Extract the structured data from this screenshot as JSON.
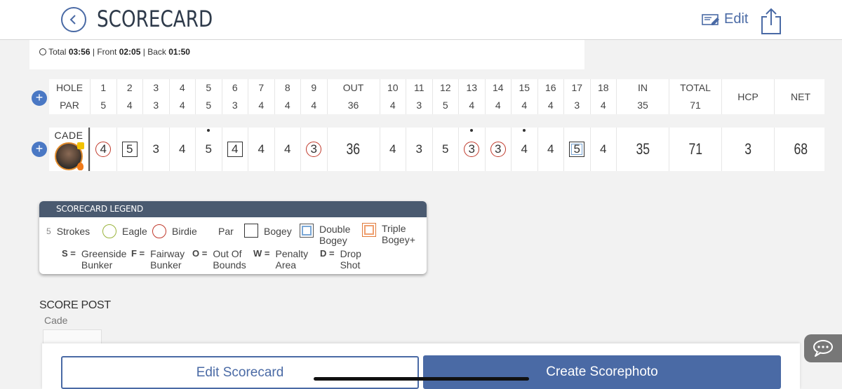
{
  "header": {
    "title": "SCORECARD",
    "edit_label": "Edit",
    "icons": [
      "back-icon",
      "edit-card-icon",
      "share-icon"
    ],
    "accent_color": "#4a6aa5"
  },
  "timebar": {
    "total_label": "Total",
    "total_value": "03:56",
    "front_label": "Front",
    "front_value": "02:05",
    "back_label": "Back",
    "back_value": "01:50",
    "sep": "|"
  },
  "holes": {
    "hole_label": "HOLE",
    "par_label": "PAR",
    "front": [
      {
        "hole": "1",
        "par": "5"
      },
      {
        "hole": "2",
        "par": "4"
      },
      {
        "hole": "3",
        "par": "3"
      },
      {
        "hole": "4",
        "par": "4"
      },
      {
        "hole": "5",
        "par": "5"
      },
      {
        "hole": "6",
        "par": "3"
      },
      {
        "hole": "7",
        "par": "4"
      },
      {
        "hole": "8",
        "par": "4"
      },
      {
        "hole": "9",
        "par": "4"
      }
    ],
    "out_label": "OUT",
    "out_par": "36",
    "back": [
      {
        "hole": "10",
        "par": "4"
      },
      {
        "hole": "11",
        "par": "3"
      },
      {
        "hole": "12",
        "par": "5"
      },
      {
        "hole": "13",
        "par": "4"
      },
      {
        "hole": "14",
        "par": "4"
      },
      {
        "hole": "15",
        "par": "4"
      },
      {
        "hole": "16",
        "par": "4"
      },
      {
        "hole": "17",
        "par": "3"
      },
      {
        "hole": "18",
        "par": "4"
      }
    ],
    "in_label": "IN",
    "in_par": "35",
    "total_label": "TOTAL",
    "total_par": "71",
    "hcp_label": "HCP",
    "net_label": "NET"
  },
  "player": {
    "name": "CADE",
    "front": [
      {
        "score": "4",
        "mark": "birdie",
        "dot": false
      },
      {
        "score": "5",
        "mark": "bogey",
        "dot": false
      },
      {
        "score": "3",
        "mark": "par",
        "dot": false
      },
      {
        "score": "4",
        "mark": "par",
        "dot": false
      },
      {
        "score": "5",
        "mark": "par",
        "dot": true
      },
      {
        "score": "4",
        "mark": "bogey",
        "dot": false
      },
      {
        "score": "4",
        "mark": "par",
        "dot": false
      },
      {
        "score": "4",
        "mark": "par",
        "dot": false
      },
      {
        "score": "3",
        "mark": "birdie",
        "dot": false
      }
    ],
    "out": "36",
    "back": [
      {
        "score": "4",
        "mark": "par",
        "dot": false
      },
      {
        "score": "3",
        "mark": "par",
        "dot": false
      },
      {
        "score": "5",
        "mark": "par",
        "dot": false
      },
      {
        "score": "3",
        "mark": "birdie",
        "dot": true
      },
      {
        "score": "3",
        "mark": "birdie",
        "dot": false
      },
      {
        "score": "4",
        "mark": "par",
        "dot": true
      },
      {
        "score": "4",
        "mark": "par",
        "dot": false
      },
      {
        "score": "5",
        "mark": "double-bogey",
        "dot": false
      },
      {
        "score": "4",
        "mark": "par",
        "dot": false
      }
    ],
    "in": "35",
    "total": "71",
    "hcp": "3",
    "net": "68"
  },
  "legend": {
    "title": "SCORECARD LEGEND",
    "strokes_sample": "5",
    "strokes": "Strokes",
    "eagle": "Eagle",
    "birdie": "Birdie",
    "par": "Par",
    "bogey": "Bogey",
    "double_bogey_1": "Double",
    "double_bogey_2": "Bogey",
    "triple_bogey_1": "Triple",
    "triple_bogey_2": "Bogey+",
    "s_abbr": "S =",
    "s_1": "Greenside",
    "s_2": "Bunker",
    "f_abbr": "F =",
    "f_1": "Fairway",
    "f_2": "Bunker",
    "o_abbr": "O =",
    "o_1": "Out Of",
    "o_2": "Bounds",
    "w_abbr": "W =",
    "w_1": "Penalty",
    "w_2": "Area",
    "d_abbr": "D =",
    "d_1": "Drop",
    "d_2": "Shot",
    "colors": {
      "eagle": "#9ab33c",
      "birdie": "#c0392b",
      "double_bogey": "#7aa7d6",
      "triple_bogey": "#e07a3a"
    }
  },
  "score_post": {
    "title": "SCORE POST",
    "name": "Cade"
  },
  "actions": {
    "edit_scorecard": "Edit Scorecard",
    "create_scorephoto": "Create Scorephoto"
  }
}
